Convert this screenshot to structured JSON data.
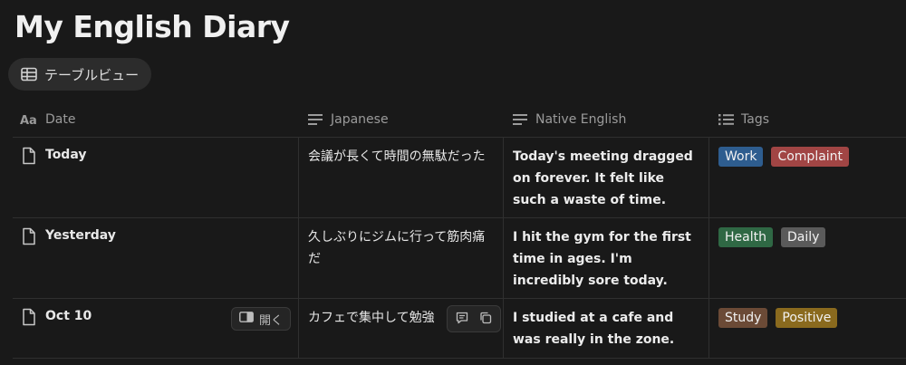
{
  "page": {
    "title": "My English Diary"
  },
  "view_tab": {
    "label": "テーブルビュー",
    "icon": "table-icon"
  },
  "columns": [
    {
      "label": "Date",
      "icon": "title-aa-icon"
    },
    {
      "label": "Japanese",
      "icon": "text-lines-icon"
    },
    {
      "label": "Native English",
      "icon": "text-lines-icon"
    },
    {
      "label": "Tags",
      "icon": "list-icon"
    }
  ],
  "rows": [
    {
      "date": "Today",
      "japanese": "会議が長くて時間の無駄だった",
      "english": "Today's meeting dragged on forever. It felt like such a waste of time.",
      "tags": [
        {
          "label": "Work",
          "color": "#2e5d8f"
        },
        {
          "label": "Complaint",
          "color": "#a14544"
        }
      ]
    },
    {
      "date": "Yesterday",
      "japanese": "久しぶりにジムに行って筋肉痛だ",
      "english": "I hit the gym for the first time in ages. I'm incredibly sore today.",
      "tags": [
        {
          "label": "Health",
          "color": "#2f6844"
        },
        {
          "label": "Daily",
          "color": "#5a5a5a"
        }
      ]
    },
    {
      "date": "Oct 10",
      "japanese": "カフェで集中して勉強",
      "english": "I studied at a cafe and was really in the zone.",
      "open_label": "開く",
      "tags": [
        {
          "label": "Study",
          "color": "#6b4a36"
        },
        {
          "label": "Positive",
          "color": "#8a6a1e"
        }
      ]
    }
  ]
}
